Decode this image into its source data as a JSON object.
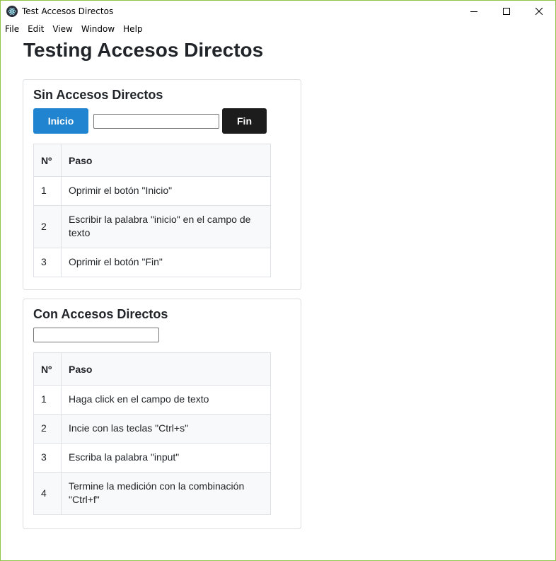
{
  "window": {
    "title": "Test Accesos Directos"
  },
  "menu": {
    "items": [
      "File",
      "Edit",
      "View",
      "Window",
      "Help"
    ]
  },
  "page": {
    "title": "Testing Accesos Directos"
  },
  "section_without": {
    "title": "Sin Accesos Directos",
    "start_button": "Inicio",
    "end_button": "Fin",
    "input_value": "",
    "table": {
      "headers": [
        "Nº",
        "Paso"
      ],
      "rows": [
        [
          "1",
          "Oprimir el botón \"Inicio\""
        ],
        [
          "2",
          "Escribir la palabra \"inicio\" en el campo de texto"
        ],
        [
          "3",
          "Oprimir el botón \"Fin\""
        ]
      ]
    }
  },
  "section_with": {
    "title": "Con Accesos Directos",
    "input_value": "",
    "table": {
      "headers": [
        "Nº",
        "Paso"
      ],
      "rows": [
        [
          "1",
          "Haga click en el campo de texto"
        ],
        [
          "2",
          "Incie con las teclas \"Ctrl+s\""
        ],
        [
          "3",
          "Escriba la palabra \"input\""
        ],
        [
          "4",
          "Termine la medición con la combinación \"Ctrl+f\""
        ]
      ]
    }
  },
  "colors": {
    "accent_blue": "#2084d0",
    "dark_button": "#1c1c1c",
    "window_border": "#8fc549"
  },
  "icons": {
    "app": "electron-icon",
    "minimize": "minimize-icon",
    "maximize": "maximize-icon",
    "close": "close-icon"
  }
}
